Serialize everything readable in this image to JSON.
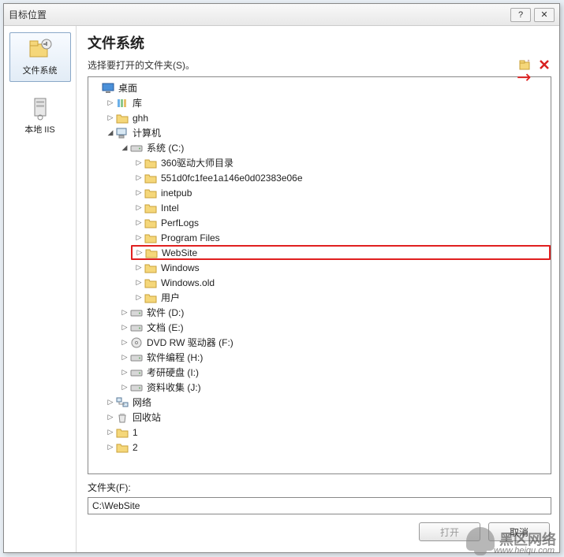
{
  "window": {
    "title": "目标位置",
    "help_glyph": "?",
    "close_glyph": "✕"
  },
  "sidebar": {
    "items": [
      {
        "label": "文件系统",
        "selected": true
      },
      {
        "label": "本地 IIS",
        "selected": false
      }
    ]
  },
  "main": {
    "heading": "文件系统",
    "subheading": "选择要打开的文件夹(S)。"
  },
  "tree": {
    "root": {
      "label": "桌面"
    },
    "lib": {
      "label": "库"
    },
    "ghh": {
      "label": "ghh"
    },
    "computer": {
      "label": "计算机"
    },
    "drive_c": {
      "label": "系统 (C:)"
    },
    "c_children": [
      "360驱动大师目录",
      "551d0fc1fee1a146e0d02383e06e",
      "inetpub",
      "Intel",
      "PerfLogs",
      "Program Files",
      "WebSite",
      "Windows",
      "Windows.old",
      "用户"
    ],
    "drives": [
      "软件 (D:)",
      "文档 (E:)",
      "DVD RW 驱动器 (F:)",
      "软件编程 (H:)",
      "考研硬盘 (I:)",
      "资料收集 (J:)"
    ],
    "network": {
      "label": "网络"
    },
    "recycle": {
      "label": "回收站"
    },
    "one": {
      "label": "1"
    },
    "two": {
      "label": "2"
    }
  },
  "folder": {
    "label": "文件夹(F):",
    "value": "C:\\WebSite"
  },
  "buttons": {
    "open": "打开",
    "cancel": "取消"
  },
  "watermark": {
    "text": "黑区网络",
    "url": "www.heiqu.com"
  }
}
